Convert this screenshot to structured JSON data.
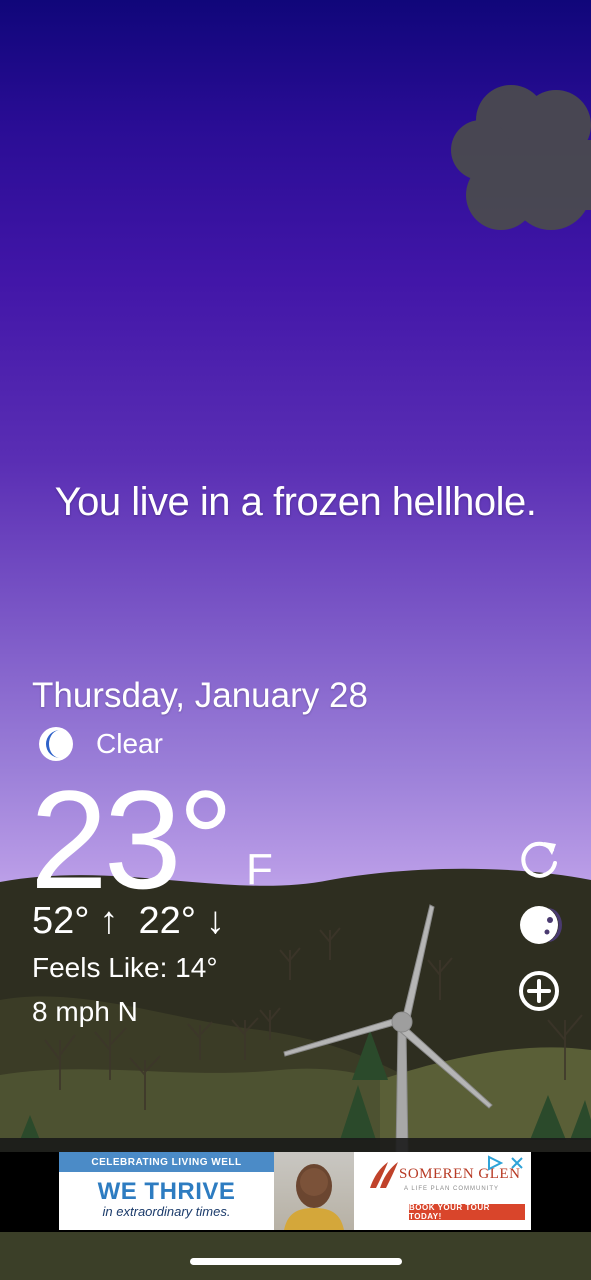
{
  "tagline": "You live in a frozen hellhole.",
  "date": "Thursday, January 28",
  "condition": {
    "icon": "moon-icon",
    "label": "Clear"
  },
  "temperature": {
    "value": "23°",
    "unit": "F"
  },
  "high": "52°",
  "high_arrow": "↑",
  "low": "22°",
  "low_arrow": "↓",
  "feels_like": "Feels Like: 14°",
  "wind": "8 mph N",
  "controls": {
    "refresh": "refresh-icon",
    "theme": "moon-phase-icon",
    "add": "add-circle-icon"
  },
  "ad": {
    "banner": "CELEBRATING LIVING WELL",
    "headline": "WE THRIVE",
    "subline": "in extraordinary times.",
    "brand": "SOMEREN GLEN",
    "brand_tagline": "A LIFE PLAN COMMUNITY",
    "cta": "BOOK YOUR TOUR TODAY!",
    "choice_icon": "ad-choices-icon",
    "close_icon": "close-icon"
  },
  "colors": {
    "sky_top": "#10067a",
    "sky_bottom": "#c7b0ef",
    "hill_dark": "#2c2c1e",
    "hill_mid": "#525735",
    "ad_blue": "#2d7cc1",
    "ad_red": "#d9452b"
  }
}
